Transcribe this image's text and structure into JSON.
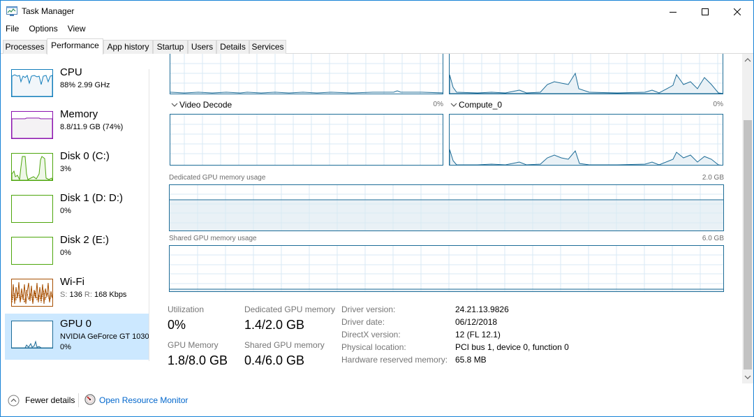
{
  "window": {
    "title": "Task Manager",
    "accent": "#1883d7"
  },
  "menu": {
    "items": [
      "File",
      "Options",
      "View"
    ]
  },
  "tabs": [
    {
      "label": "Processes",
      "active": false
    },
    {
      "label": "Performance",
      "active": true
    },
    {
      "label": "App history",
      "active": false
    },
    {
      "label": "Startup",
      "active": false
    },
    {
      "label": "Users",
      "active": false
    },
    {
      "label": "Details",
      "active": false
    },
    {
      "label": "Services",
      "active": false
    }
  ],
  "sidebar": {
    "items": [
      {
        "title": "CPU",
        "sub": "88%  2.99 GHz",
        "color": "#117dbb"
      },
      {
        "title": "Memory",
        "sub": "8.8/11.9 GB (74%)",
        "color": "#8b12ae"
      },
      {
        "title": "Disk 0 (C:)",
        "sub": "3%",
        "color": "#4da60c"
      },
      {
        "title": "Disk 1 (D: D:)",
        "sub": "0%",
        "color": "#4da60c"
      },
      {
        "title": "Disk 2 (E:)",
        "sub": "0%",
        "color": "#4da60c"
      },
      {
        "title": "Wi-Fi",
        "sub_prefix_s": "S:",
        "sub_s": "136",
        "sub_prefix_r": "R:",
        "sub_r": "168 Kbps",
        "color": "#a74f01"
      },
      {
        "title": "GPU 0",
        "sub": "NVIDIA GeForce GT 1030",
        "sub2": "0%",
        "color": "#1d6c97",
        "selected": true
      }
    ]
  },
  "gpu": {
    "engines": [
      {
        "label": "Video Decode",
        "value": "0%"
      },
      {
        "label": "Compute_0",
        "value": "0%"
      }
    ],
    "dedicated_memory": {
      "label": "Dedicated GPU memory usage",
      "max": "2.0 GB",
      "fill_fraction": 0.7
    },
    "shared_memory": {
      "label": "Shared GPU memory usage",
      "max": "6.0 GB",
      "fill_fraction": 0.067
    },
    "stats": {
      "utilization_label": "Utilization",
      "utilization": "0%",
      "dedicated_label": "Dedicated GPU memory",
      "dedicated": "1.4/2.0 GB",
      "gpu_memory_label": "GPU Memory",
      "gpu_memory": "1.8/8.0 GB",
      "shared_label": "Shared GPU memory",
      "shared": "0.4/6.0 GB"
    },
    "info": [
      {
        "label": "Driver version:",
        "value": "24.21.13.9826"
      },
      {
        "label": "Driver date:",
        "value": "06/12/2018"
      },
      {
        "label": "DirectX version:",
        "value": "12 (FL 12.1)"
      },
      {
        "label": "Physical location:",
        "value": "PCI bus 1, device 0, function 0"
      },
      {
        "label": "Hardware reserved memory:",
        "value": "65.8 MB"
      }
    ]
  },
  "footer": {
    "fewer_details": "Fewer details",
    "open_resource_monitor": "Open Resource Monitor"
  }
}
